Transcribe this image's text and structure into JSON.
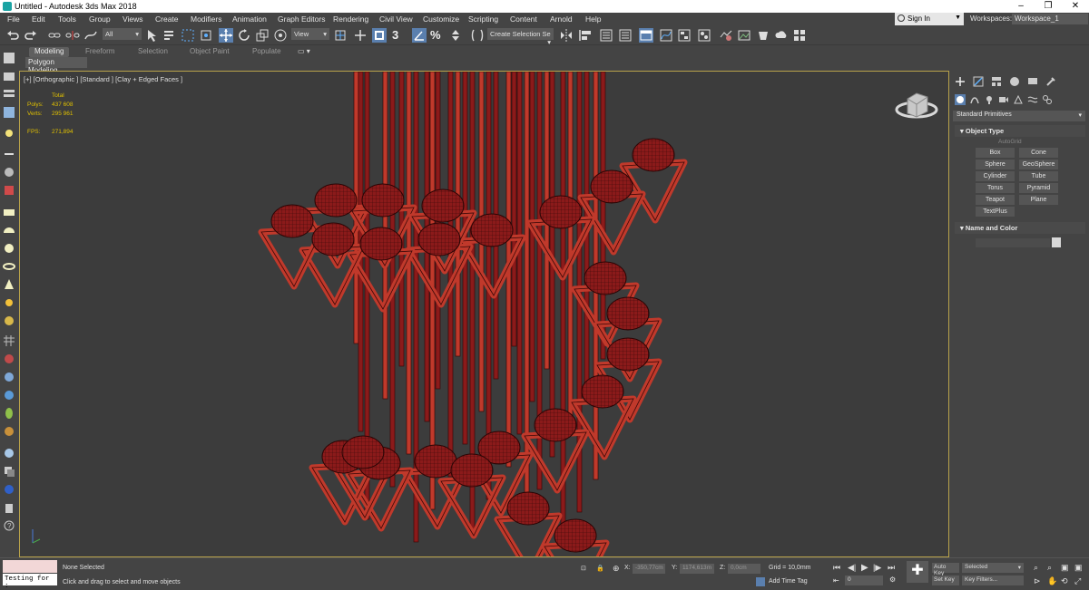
{
  "window": {
    "title": "Untitled - Autodesk 3ds Max 2018",
    "minimize": "–",
    "maximize": "❐",
    "close": "✕"
  },
  "menu": [
    "File",
    "Edit",
    "Tools",
    "Group",
    "Views",
    "Create",
    "Modifiers",
    "Animation",
    "Graph Editors",
    "Rendering",
    "Civil View",
    "Customize",
    "Scripting",
    "Content",
    "Arnold",
    "Help"
  ],
  "account": {
    "sign_in": "Sign In",
    "workspaces_label": "Workspaces:",
    "workspace": "Workspace_1"
  },
  "toolbar": {
    "filter_value": "All",
    "ref_coord": "View",
    "selection_set_placeholder": "Create Selection Se",
    "snap_label": "3",
    "percent_label": "%"
  },
  "ribbon": {
    "tabs": [
      "Modeling",
      "Freeform",
      "Selection",
      "Object Paint",
      "Populate"
    ],
    "active_tab": "Modeling",
    "sub_label": "Polygon Modeling"
  },
  "viewport": {
    "label": "[+] [Orthographic ] [Standard ] [Clay + Edged Faces ]",
    "stats": {
      "total_label": "Total",
      "polys_label": "Polys:",
      "polys": "437 608",
      "verts_label": "Verts:",
      "verts": "295 961",
      "fps_label": "FPS:",
      "fps": "271,894"
    },
    "model_color": "#8b1a1a",
    "highlight_color": "#c0392b",
    "frame_color": "#b8a24a"
  },
  "command_panel": {
    "dropdown": "Standard Primitives",
    "object_type_title": "Object Type",
    "autogrid": "AutoGrid",
    "buttons": [
      "Box",
      "Cone",
      "Sphere",
      "GeoSphere",
      "Cylinder",
      "Tube",
      "Torus",
      "Pyramid",
      "Teapot",
      "Plane",
      "TextPlus"
    ],
    "name_color_title": "Name and Color"
  },
  "status": {
    "script_text": "Testing for :",
    "selection": "None Selected",
    "prompt": "Click and drag to select and move objects",
    "x_label": "X:",
    "x_value": "-350,77cm",
    "y_label": "Y:",
    "y_value": "1174,613m",
    "z_label": "Z:",
    "z_value": "0,0cm",
    "grid": "Grid = 10,0mm",
    "add_time_tag": "Add Time Tag",
    "auto_key": "Auto Key",
    "selected": "Selected",
    "set_key": "Set Key",
    "key_filters": "Key Filters...",
    "frame": "0"
  }
}
